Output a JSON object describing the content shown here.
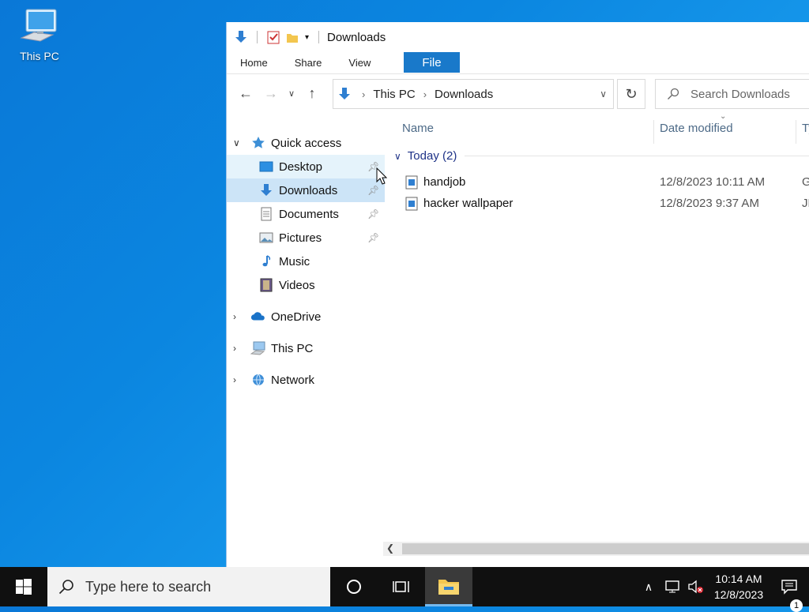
{
  "desktop": {
    "icons": [
      {
        "label": "This PC",
        "icon": "this-pc-icon"
      }
    ]
  },
  "window": {
    "title": "Downloads",
    "ribbon_tabs": [
      "File",
      "Home",
      "Share",
      "View"
    ],
    "address": {
      "crumbs": [
        "This PC",
        "Downloads"
      ]
    },
    "search_placeholder": "Search Downloads",
    "nav_pane": {
      "quick_access": "Quick access",
      "items": [
        {
          "label": "Desktop",
          "icon": "desktop-icon",
          "pinned": true
        },
        {
          "label": "Downloads",
          "icon": "downloads-icon",
          "pinned": true
        },
        {
          "label": "Documents",
          "icon": "documents-icon",
          "pinned": true
        },
        {
          "label": "Pictures",
          "icon": "pictures-icon",
          "pinned": true
        },
        {
          "label": "Music",
          "icon": "music-icon",
          "pinned": false
        },
        {
          "label": "Videos",
          "icon": "videos-icon",
          "pinned": false
        }
      ],
      "roots": [
        {
          "label": "OneDrive",
          "icon": "onedrive-icon"
        },
        {
          "label": "This PC",
          "icon": "this-pc-icon"
        },
        {
          "label": "Network",
          "icon": "network-icon"
        }
      ]
    },
    "columns": {
      "name": "Name",
      "date": "Date modified",
      "type": "Ty"
    },
    "group": "Today (2)",
    "files": [
      {
        "name": "handjob",
        "date": "12/8/2023 10:11 AM",
        "type": "G"
      },
      {
        "name": "hacker wallpaper",
        "date": "12/8/2023 9:37 AM",
        "type": "JF"
      }
    ]
  },
  "taskbar": {
    "search_placeholder": "Type here to search",
    "time": "10:14 AM",
    "date": "12/8/2023",
    "notification_count": "1"
  },
  "colors": {
    "accent": "#1979ca",
    "selection": "#cce4f7",
    "hover": "#e5f3fb",
    "taskbar": "#101010"
  }
}
